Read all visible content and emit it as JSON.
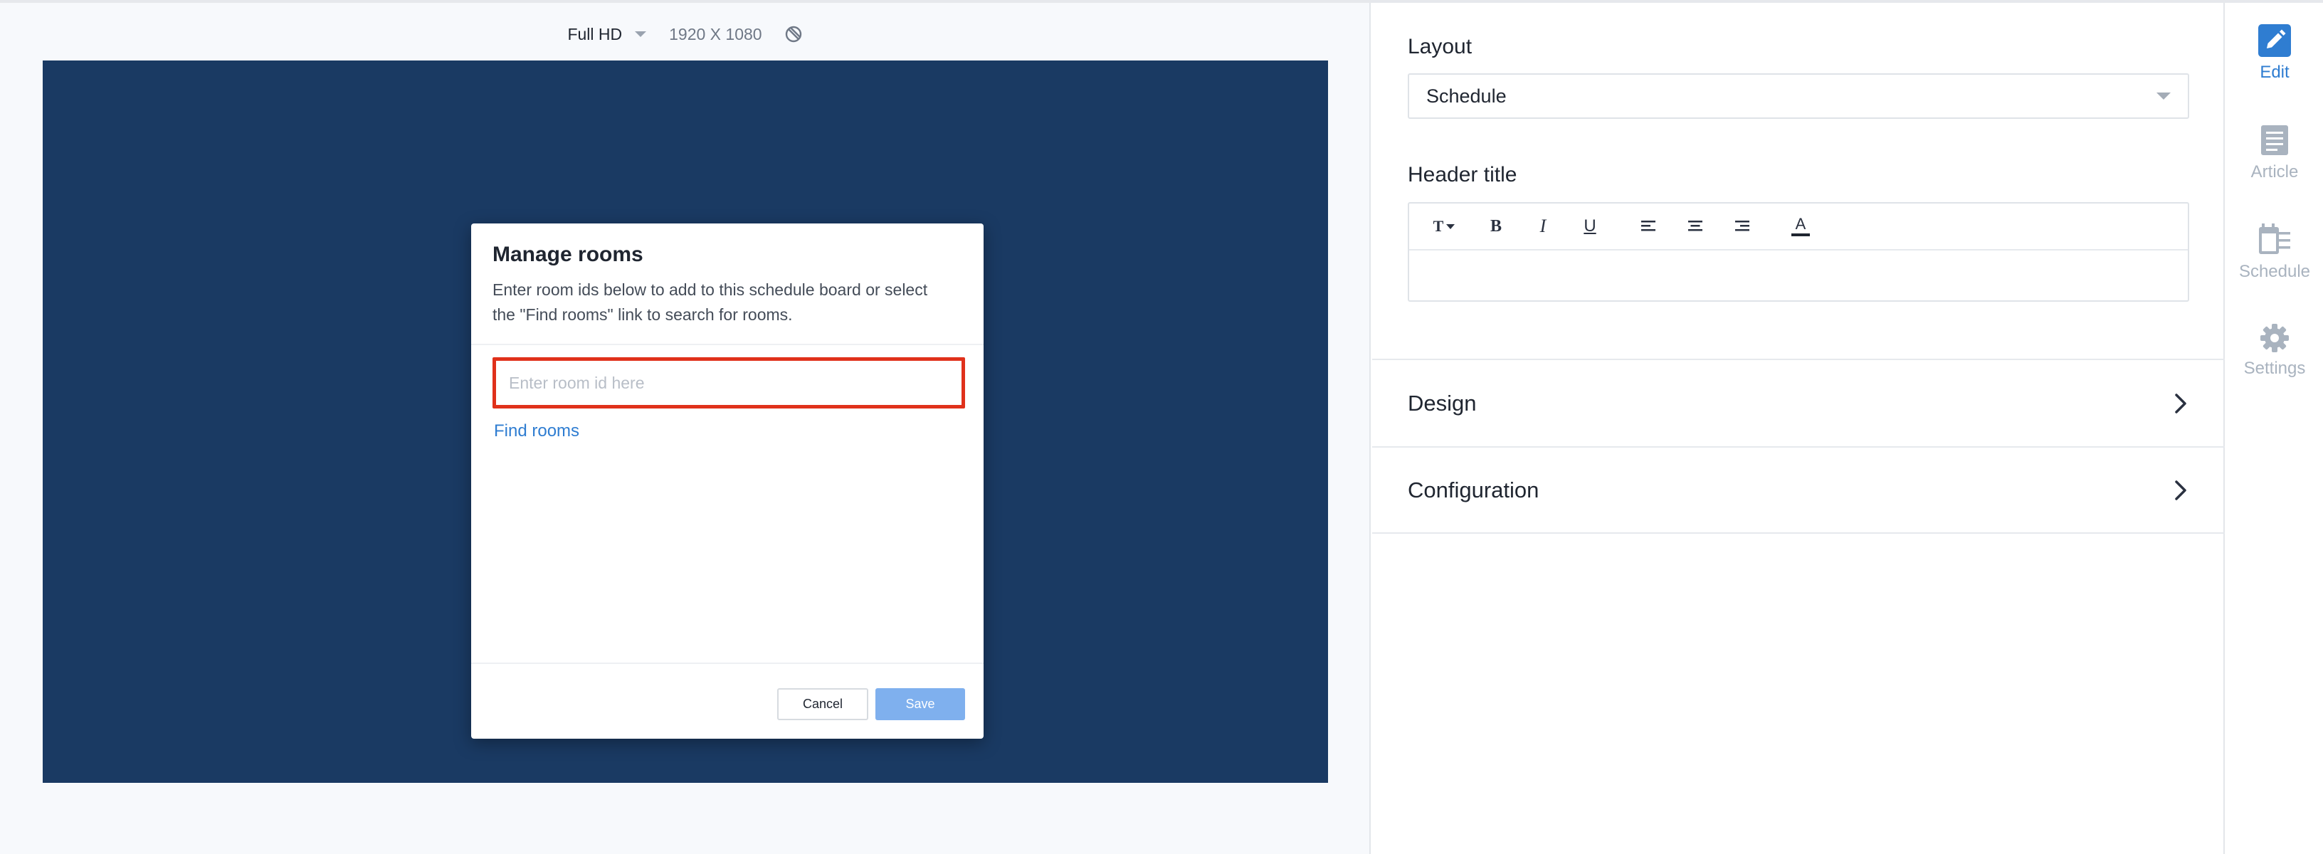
{
  "preview": {
    "resolution_label": "Full HD",
    "resolution_dims": "1920 X 1080"
  },
  "dialog": {
    "title": "Manage rooms",
    "description_line1": "Enter room ids below to add to this schedule board or select",
    "description_line2": "the \"Find rooms\" link to search for rooms.",
    "input_placeholder": "Enter room id here",
    "input_value": "",
    "find_link": "Find rooms",
    "cancel_label": "Cancel",
    "save_label": "Save"
  },
  "panel": {
    "layout_label": "Layout",
    "layout_value": "Schedule",
    "header_title_label": "Header title",
    "header_title_value": "",
    "toolbar": {
      "text_size_glyph": "T",
      "bold_glyph": "B",
      "italic_glyph": "I",
      "underline_glyph": "U",
      "color_glyph": "A"
    },
    "sections": [
      {
        "label": "Design"
      },
      {
        "label": "Configuration"
      }
    ]
  },
  "rail": {
    "items": [
      {
        "label": "Edit",
        "icon": "pencil-icon",
        "active": true
      },
      {
        "label": "Article",
        "icon": "article-icon",
        "active": false
      },
      {
        "label": "Schedule",
        "icon": "schedule-icon",
        "active": false
      },
      {
        "label": "Settings",
        "icon": "gear-icon",
        "active": false
      }
    ]
  },
  "colors": {
    "screen_background": "#1a3a63",
    "accent": "#2f7dd1",
    "save_button": "#7fb0ee",
    "input_highlight": "#e0311b",
    "inactive_icon": "#a9b3bf"
  }
}
